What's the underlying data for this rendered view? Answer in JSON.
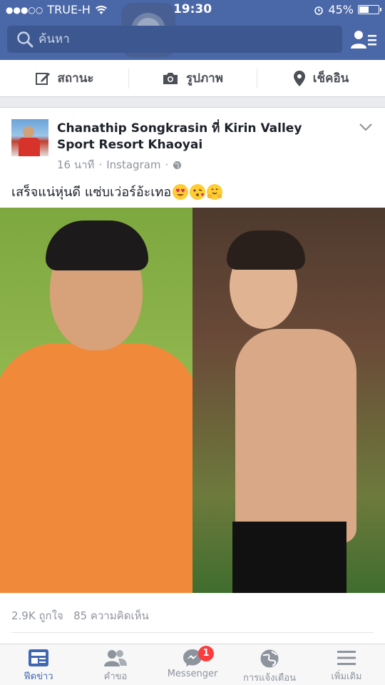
{
  "status_bar": {
    "carrier": "TRUE-H",
    "time": "19:30",
    "battery": "45%",
    "battery_level": 0.45
  },
  "header": {
    "search_placeholder": "ค้นหา"
  },
  "composer": {
    "status_label": "สถานะ",
    "photo_label": "รูปภาพ",
    "checkin_label": "เช็คอิน"
  },
  "post": {
    "title": "Chanathip Songkrasin ที่ Kirin Valley Sport Resort Khaoyai",
    "time": "16 นาที",
    "source": "Instagram",
    "text": "เสร็จแน่หุ่นดี แซ่บเว่อร์อ้ะเทอ",
    "likes": "2.9K ถูกใจ",
    "comments": "85 ความคิดเห็น"
  },
  "tabs": [
    {
      "label": "ฟีดข่าว",
      "icon": "news-feed-icon",
      "active": true
    },
    {
      "label": "คำขอ",
      "icon": "friend-requests-icon",
      "active": false
    },
    {
      "label": "Messenger",
      "icon": "messenger-icon",
      "active": false,
      "badge": "1"
    },
    {
      "label": "การแจ้งเตือน",
      "icon": "globe-icon",
      "active": false
    },
    {
      "label": "เพิ่มเติม",
      "icon": "menu-icon",
      "active": false
    }
  ],
  "colors": {
    "brand_blue": "#4a67a8",
    "active_tab": "#4267b2",
    "badge": "#fa3e3e"
  }
}
